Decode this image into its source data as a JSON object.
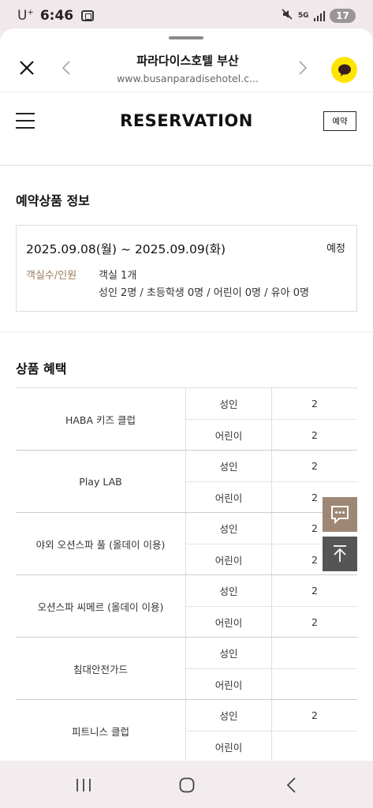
{
  "status_bar": {
    "carrier": "U",
    "carrier_sup": "+",
    "time": "6:46",
    "network": "5G",
    "battery": "17"
  },
  "browser": {
    "title": "파라다이스호텔 부산",
    "url": "www.busanparadisehotel.c..."
  },
  "header": {
    "title": "RESERVATION",
    "reserve_button": "예약"
  },
  "reservation_info": {
    "section_title": "예약상품 정보",
    "date_range": "2025.09.08(월) ~ 2025.09.09(화)",
    "status": "예정",
    "rooms_label": "객실수/인원",
    "rooms_value": "객실 1개",
    "guests_value": "성인 2명 / 초등학생 0명 / 어린이 0명 / 유아 0명"
  },
  "benefits": {
    "section_title": "상품 혜택",
    "groups": [
      {
        "name": "HABA 키즈 클럽",
        "rows": [
          {
            "type": "성인",
            "count": "2"
          },
          {
            "type": "어린이",
            "count": "2"
          }
        ]
      },
      {
        "name": "Play LAB",
        "rows": [
          {
            "type": "성인",
            "count": "2"
          },
          {
            "type": "어린이",
            "count": "2"
          }
        ]
      },
      {
        "name": "야외 오션스파 풀 (올데이 이용)",
        "rows": [
          {
            "type": "성인",
            "count": "2"
          },
          {
            "type": "어린이",
            "count": "2"
          }
        ]
      },
      {
        "name": "오션스파 씨메르 (올데이 이용)",
        "rows": [
          {
            "type": "성인",
            "count": "2"
          },
          {
            "type": "어린이",
            "count": "2"
          }
        ]
      },
      {
        "name": "침대안전가드",
        "rows": [
          {
            "type": "성인",
            "count": ""
          },
          {
            "type": "어린이",
            "count": ""
          }
        ]
      },
      {
        "name": "피트니스 클럽",
        "rows": [
          {
            "type": "성인",
            "count": "2"
          },
          {
            "type": "어린이",
            "count": ""
          }
        ]
      }
    ]
  },
  "colors": {
    "kakao_yellow": "#fee500",
    "accent_brown": "#9a7b5a",
    "chat_button": "#9e8774",
    "top_button": "#555555"
  },
  "icons": {
    "close": "close-icon",
    "back": "chevron-left-icon",
    "forward": "chevron-right-icon",
    "talk": "kakaotalk-icon",
    "menu": "hamburger-icon",
    "chat": "chat-bubble-icon",
    "scroll_top": "arrow-up-icon"
  }
}
